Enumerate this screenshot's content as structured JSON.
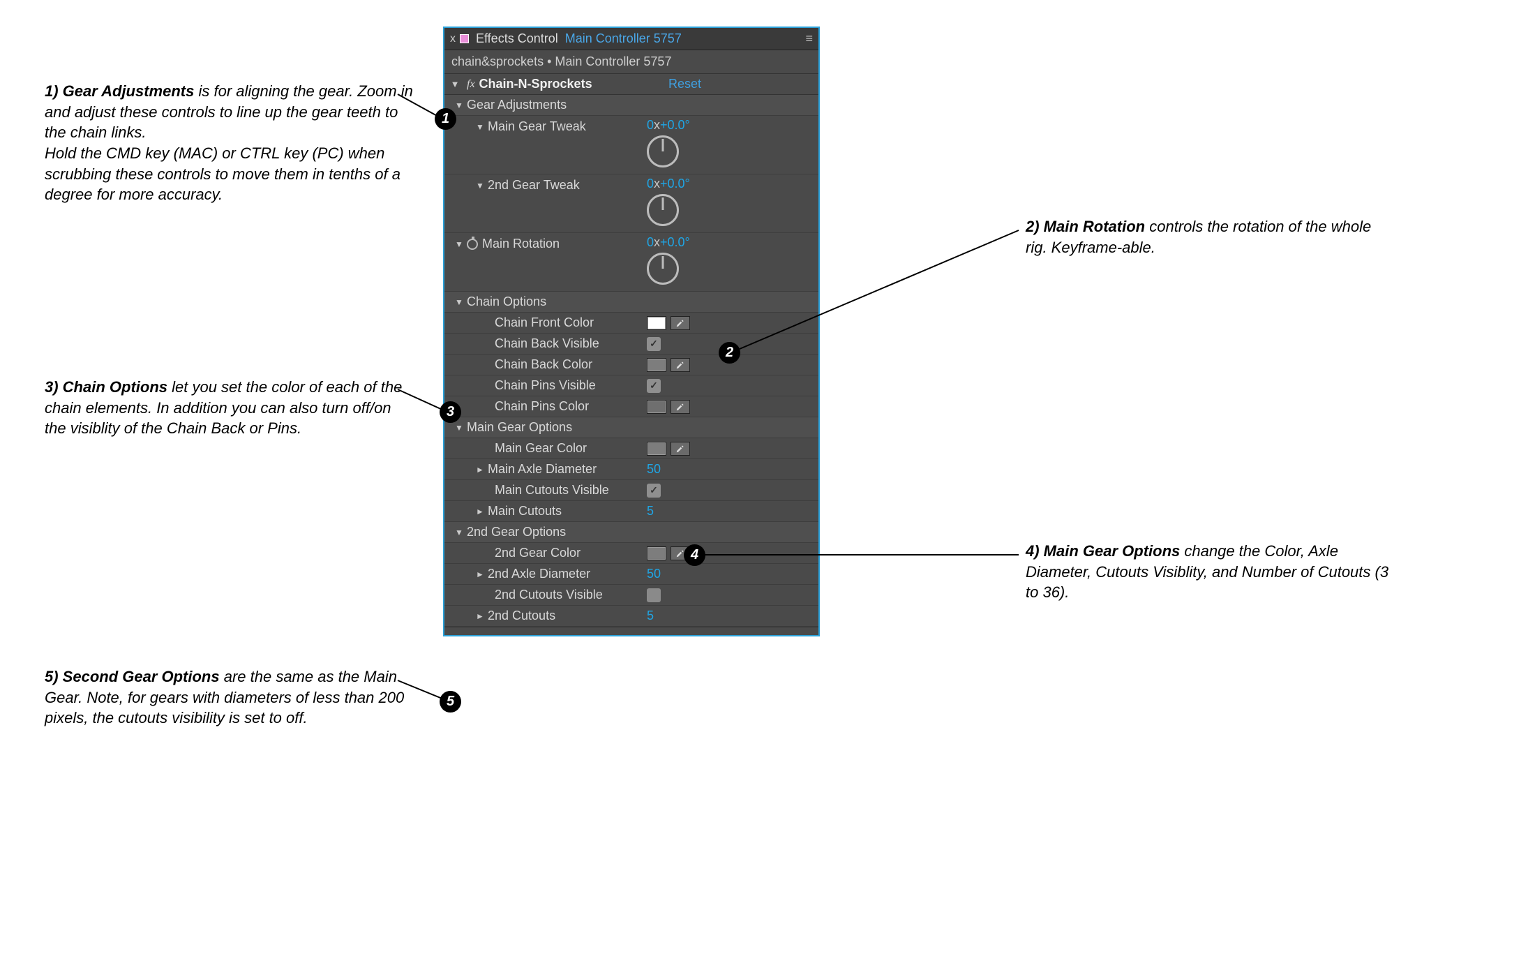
{
  "tab": {
    "close": "x",
    "title": "Effects Control",
    "subject": "Main Controller 5757",
    "menu_glyph": "≡"
  },
  "breadcrumb": "chain&sprockets • Main Controller 5757",
  "effect": {
    "name": "Chain-N-Sprockets",
    "reset": "Reset"
  },
  "groups": {
    "gear_adjustments": {
      "label": "Gear Adjustments",
      "main_gear_tweak": {
        "label": "Main Gear Tweak",
        "turns": "0",
        "deg": "+0.0°"
      },
      "second_gear_tweak": {
        "label": "2nd Gear Tweak",
        "turns": "0",
        "deg": "+0.0°"
      }
    },
    "main_rotation": {
      "label": "Main Rotation",
      "turns": "0",
      "deg": "+0.0°"
    },
    "chain_options": {
      "label": "Chain Options",
      "front_color": {
        "label": "Chain Front Color",
        "swatch": "#ffffff"
      },
      "back_visible": {
        "label": "Chain Back Visible",
        "checked": true
      },
      "back_color": {
        "label": "Chain Back Color",
        "swatch": "#7d7d7d"
      },
      "pins_visible": {
        "label": "Chain Pins Visible",
        "checked": true
      },
      "pins_color": {
        "label": "Chain Pins Color",
        "swatch": "#6f6f6f"
      }
    },
    "main_gear_options": {
      "label": "Main Gear Options",
      "color": {
        "label": "Main Gear Color",
        "swatch": "#7d7d7d"
      },
      "axle": {
        "label": "Main Axle Diameter",
        "value": "50"
      },
      "cutouts_visible": {
        "label": "Main Cutouts Visible",
        "checked": true
      },
      "cutouts": {
        "label": "Main Cutouts",
        "value": "5"
      }
    },
    "second_gear_options": {
      "label": "2nd Gear Options",
      "color": {
        "label": "2nd Gear Color",
        "swatch": "#7d7d7d"
      },
      "axle": {
        "label": "2nd Axle Diameter",
        "value": "50"
      },
      "cutouts_visible": {
        "label": "2nd Cutouts Visible",
        "checked": false
      },
      "cutouts": {
        "label": "2nd Cutouts",
        "value": "5"
      }
    }
  },
  "annotations": {
    "a1": {
      "title": "1) Gear Adjustments",
      "body": " is for aligning the gear. Zoom in and adjust these controls to line up the gear teeth to the chain links.\nHold the CMD key (MAC) or CTRL key (PC) when scrubbing these controls to move them in tenths of a degree for more accuracy."
    },
    "a2": {
      "title": "2) Main Rotation",
      "body": " controls the rotation of the whole rig. Keyframe-able."
    },
    "a3": {
      "title": "3) Chain Options",
      "body": " let you set the color of each of the  chain elements. In addition you can also turn off/on the visiblity of the Chain Back or Pins."
    },
    "a4": {
      "title": "4) Main Gear Options",
      "body": " change the Color, Axle Diameter, Cutouts Visiblity, and Number of Cutouts (3 to 36)."
    },
    "a5": {
      "title": "5) Second Gear Options",
      "body": " are the same as the Main Gear. Note, for gears with diameters of less than 200 pixels, the cutouts visibility is set to off."
    }
  },
  "glyphs": {
    "tri_down": "▼",
    "tri_right": "►",
    "check": "✓"
  }
}
